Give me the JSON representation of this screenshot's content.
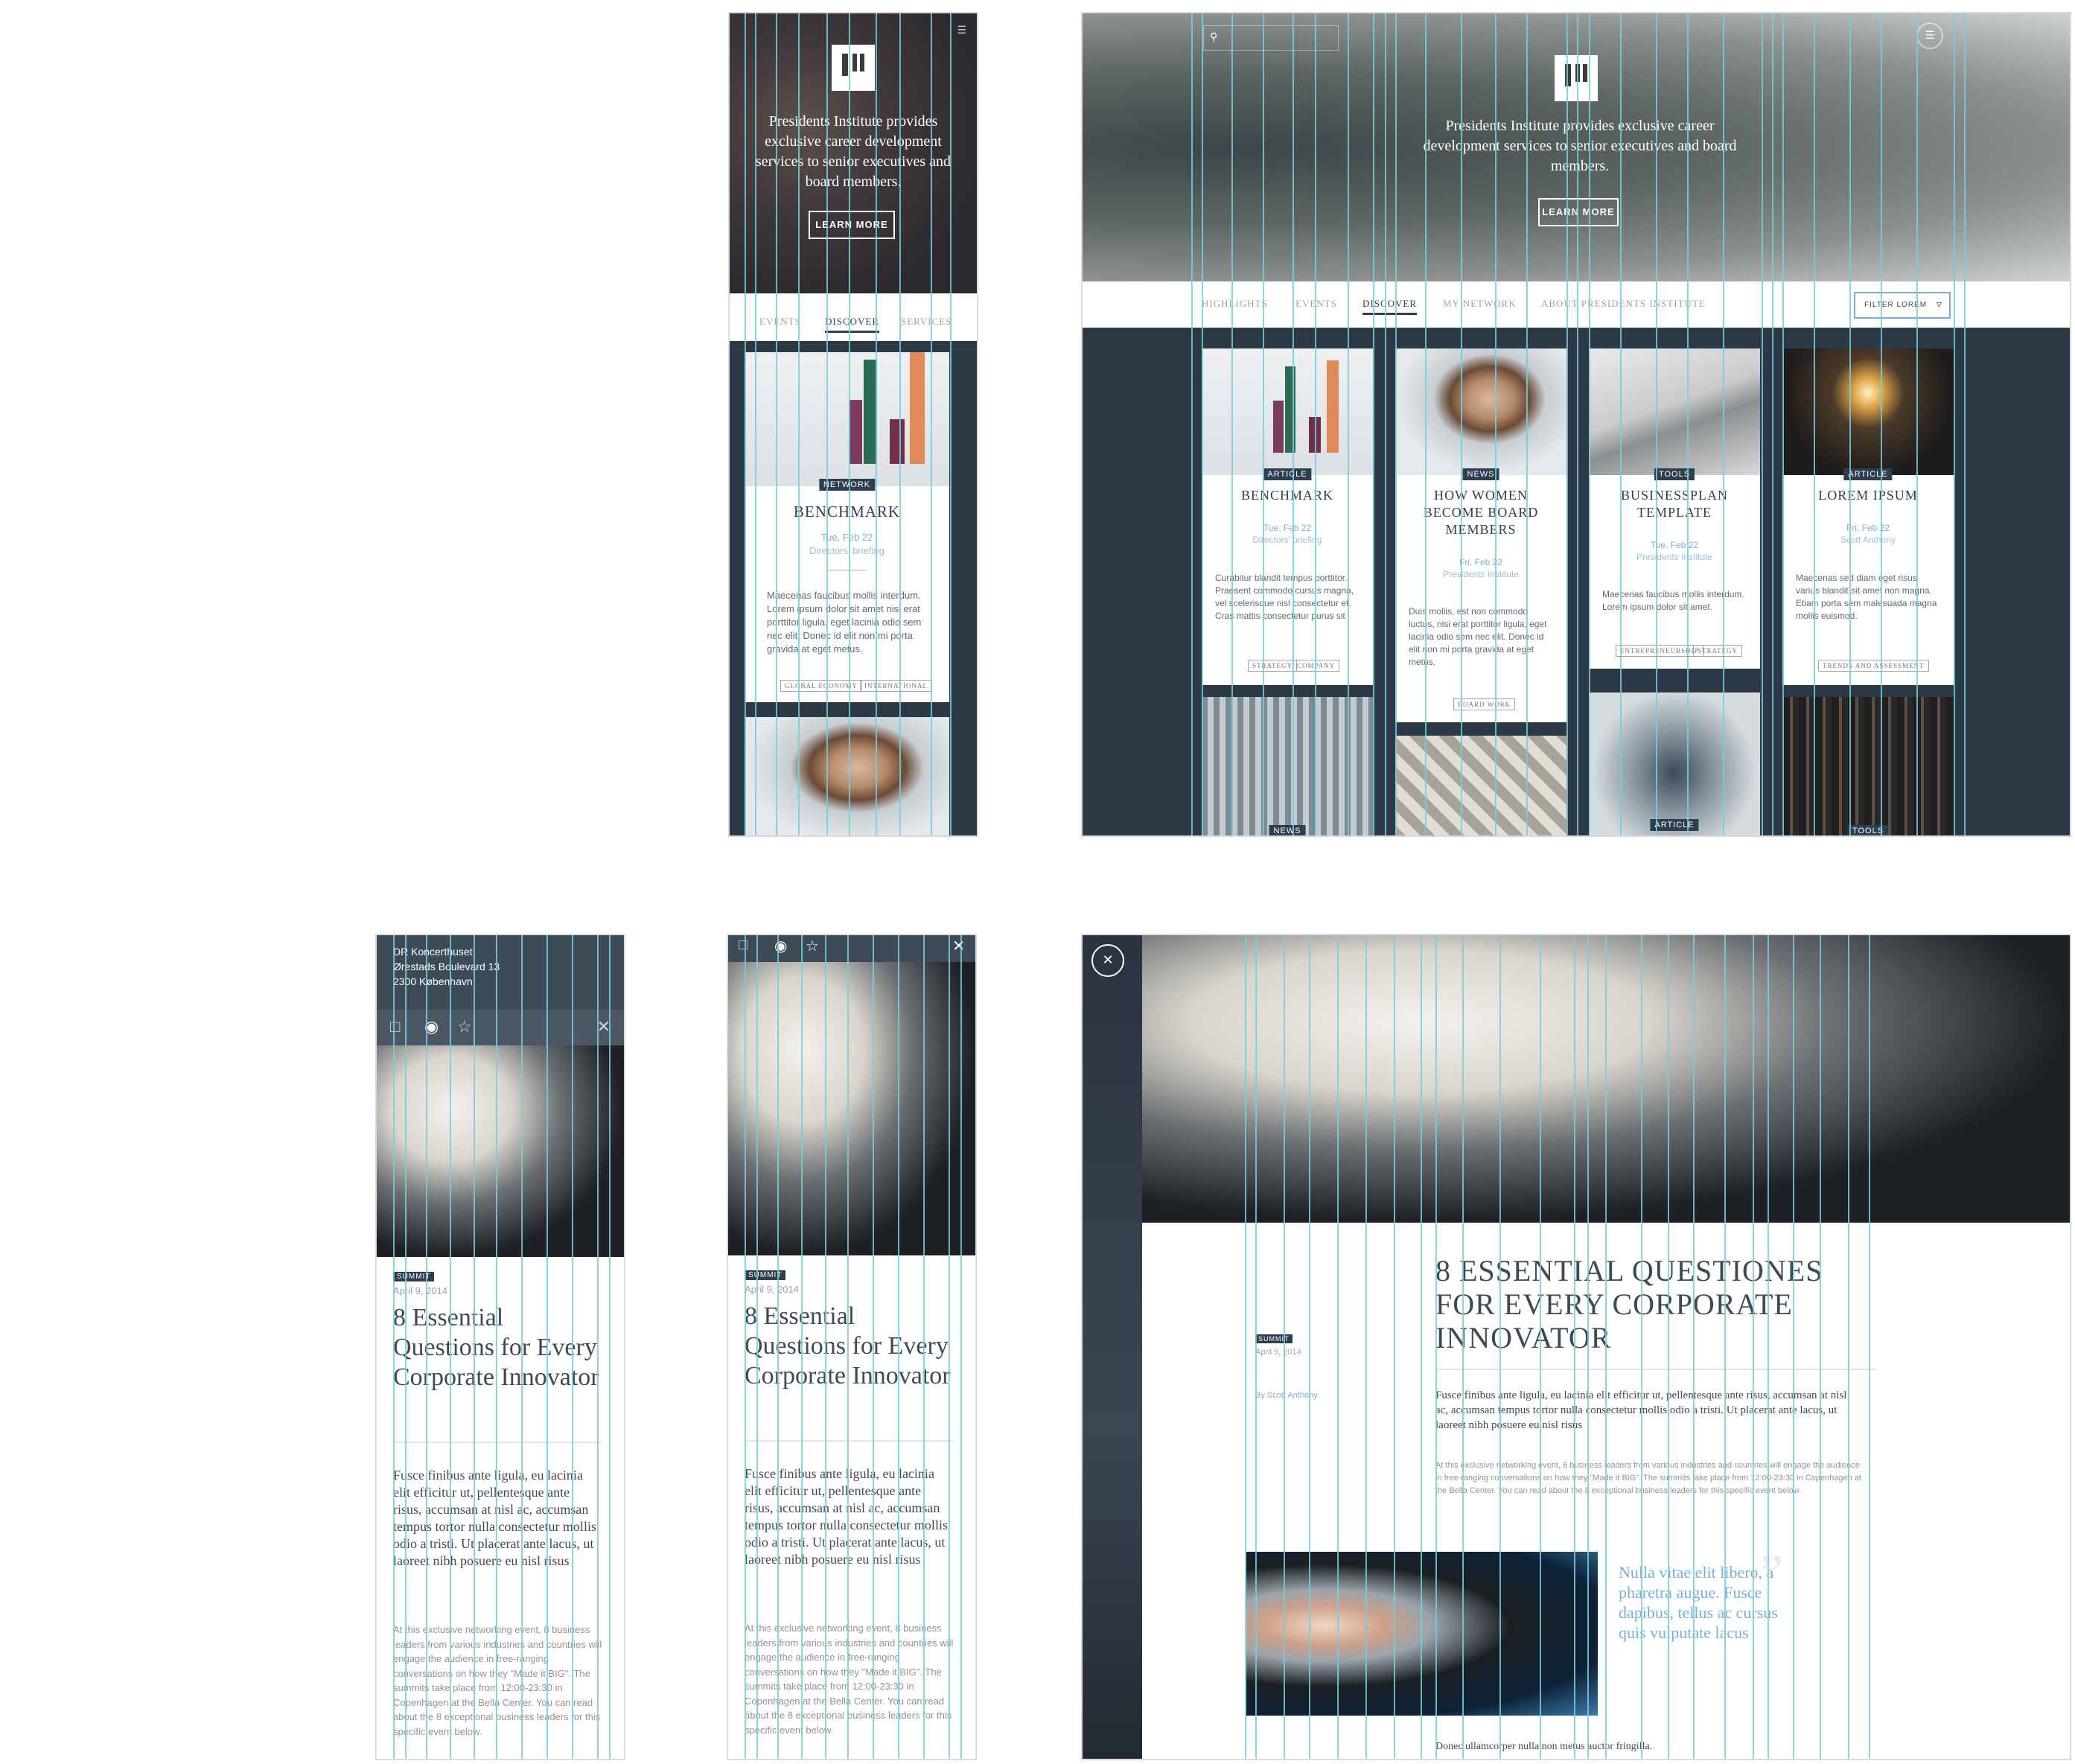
{
  "hero": {
    "tagline": "Presidents Institute provides exclusive career development services to senior executives and board members.",
    "cta_label": "LEARN MORE"
  },
  "mobile_nav": [
    "EVENTS",
    "DISCOVER",
    "SERVICES"
  ],
  "desktop_nav": [
    "HIGHLIGHTS",
    "EVENTS",
    "DISCOVER",
    "MY NETWORK",
    "ABOUT PRESIDENTS INSTITUTE"
  ],
  "active_tab": "DISCOVER",
  "filter_label": "FILTER LOREM",
  "mobile_card": {
    "badge": "NETWORK",
    "title": "BENCHMARK",
    "date": "Tue, Feb 22",
    "author": "Directors' briefing",
    "body": "Maecenas faucibus mollis interdum. Lorem ipsum dolor sit amet nisi erat porttitor ligula, eget lacinia odio sem nec elit. Donec id elit non mi porta gravida at eget metus.",
    "tags": [
      "GLOBAL ECONOMY",
      "INTERNATIONAL"
    ]
  },
  "cards": [
    {
      "badge": "ARTICLE",
      "title": "BENCHMARK",
      "date": "Tue, Feb 22",
      "author": "Directors' briefing",
      "body": "Curabitur blandit tempus porttitor. Praesent commodo cursus magna, vel scelerisque nisl consectetur et. Cras mattis consectetur purus sit",
      "tags": [
        "STRATEGY",
        "COMPANY"
      ]
    },
    {
      "badge": "NEWS",
      "title": "HOW WOMEN BECOME BOARD MEMBERS",
      "date": "Fri, Feb 22",
      "author": "Presidents Institute",
      "body": "Duis mollis, est non commodo luctus, nisi erat porttitor ligula, eget lacinia odio sem nec elit. Donec id elit non mi porta gravida at eget metus.",
      "tags": [
        "BOARD WORK"
      ]
    },
    {
      "badge": "TOOLS",
      "title": "BUSINESSPLAN TEMPLATE",
      "date": "Tue, Feb 22",
      "author": "Presidents Institute",
      "body": "Maecenas faucibus mollis interdum. Lorem ipsum dolor sit amet.",
      "tags": [
        "ENTREPRENEURSHIP",
        "STRATEGY"
      ]
    },
    {
      "badge": "ARTICLE",
      "title": "LOREM IPSUM",
      "date": "Fri, Feb 22",
      "author": "Scott Anthony",
      "body": "Maecenas sed diam eget risus varius blandit sit amet non magna. Etiam porta sem malesuada magna mollis euismod.",
      "tags": [
        "TRENDS AND ASSESSMENT"
      ]
    }
  ],
  "row2_badges": [
    "NEWS",
    "ARTICLE",
    "TOOLS"
  ],
  "location": {
    "venue": "DR Koncerthuset",
    "street": "Ørestads Boulevard 13",
    "city": "2300 København"
  },
  "article": {
    "badge": "SUMMIT",
    "date": "April 9, 2014",
    "title": "8 Essential Questions for Every Corporate Innovator",
    "title_desktop": "8 ESSENTIAL QUESTIONES FOR EVERY CORPORATE INNOVATOR",
    "lead": "Fusce finibus ante ligula, eu lacinia elit efficitur ut, pellentesque ante risus, accumsan at nisl ac, accumsan tempus tortor nulla consectetur mollis odio a tristi. Ut placerat ante lacus, ut laoreet nibh posuere eu nisl risus",
    "body": "At this exclusive networking event, 8 business leaders from various industries and countries will engage the audience in free-ranging conversations on how they \"Made it BIG\". The summits take place from 12:00-23:30 in Copenhagen at the Bella Center. You can read about the 8 exceptional business leaders for this specific event below.",
    "byline": "By Scott Anthony",
    "quote": "Nulla vitae elit libero, a pharetra augue. Fusce dapibus, tellus ac cursus quis vulputate lacus",
    "footer_fragment": "Donec ullamcorper nulla non metus auctor fringilla."
  },
  "colors": {
    "navy": "#2c3a47",
    "accent_blue": "#7aaed8",
    "guide_cyan": "#78cddc"
  }
}
